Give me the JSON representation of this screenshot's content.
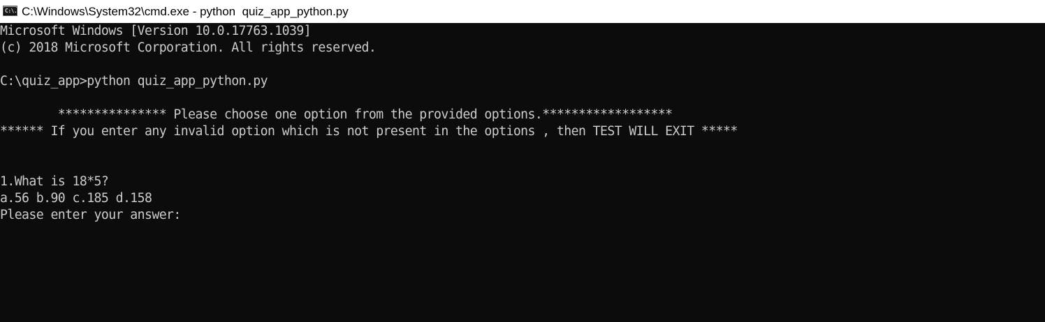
{
  "window": {
    "title": "C:\\Windows\\System32\\cmd.exe - python  quiz_app_python.py",
    "icon": "cmd-console-icon",
    "icon_text": "C:\\."
  },
  "console": {
    "lines": [
      "Microsoft Windows [Version 10.0.17763.1039]",
      "(c) 2018 Microsoft Corporation. All rights reserved.",
      "",
      "C:\\quiz_app>python quiz_app_python.py",
      "",
      "        *************** Please choose one option from the provided options.******************",
      "****** If you enter any invalid option which is not present in the options , then TEST WILL EXIT *****",
      "",
      "",
      "1.What is 18*5?",
      "a.56 b.90 c.185 d.158",
      "Please enter your answer: "
    ]
  },
  "colors": {
    "console_background": "#0c0c0c",
    "console_text": "#cccccc",
    "titlebar_background": "#ffffff",
    "titlebar_text": "#000000"
  }
}
